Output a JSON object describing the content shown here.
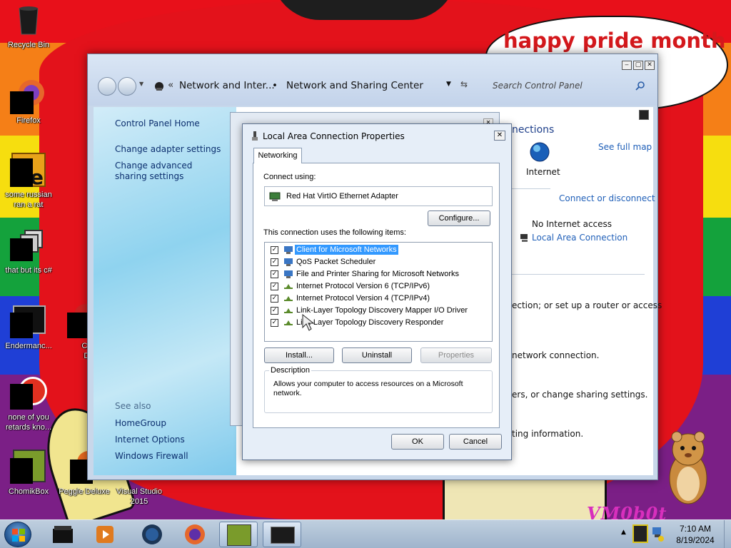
{
  "desktop": {
    "bubble_text": "happy pride month",
    "watermark_text": "VM0b0t",
    "icons": [
      {
        "label": "Recycle Bin"
      },
      {
        "label": "Firefox"
      },
      {
        "label": "some russian ran a rat"
      },
      {
        "label": "that but its c#"
      },
      {
        "label": "Endermanc..."
      },
      {
        "label": "Chuz Delu"
      },
      {
        "label": "none of you retards kno..."
      },
      {
        "label": "ChomikBox"
      },
      {
        "label": "Peggle Deluxe"
      },
      {
        "label": "Visual Studio 2015"
      }
    ]
  },
  "explorer": {
    "breadcrumb": {
      "sep1": "«",
      "part1": "Network and Inter...",
      "sep2": "•",
      "part2": "Network and Sharing Center"
    },
    "search_placeholder": "Search Control Panel",
    "sidebar": {
      "home": "Control Panel Home",
      "links": [
        "Change adapter settings",
        "Change advanced sharing settings"
      ],
      "see_also": "See also",
      "see_also_links": [
        "HomeGroup",
        "Internet Options",
        "Windows Firewall"
      ]
    },
    "main": {
      "connections_heading_fragment": "nections",
      "see_full_map": "See full map",
      "internet_label": "Internet",
      "connect_disconnect": "Connect or disconnect",
      "no_internet_access": "No Internet access",
      "local_area_connection": "Local Area Connection",
      "frag_router": "ection; or set up a router or access",
      "frag_network": "network connection.",
      "frag_sharing": "ers, or change sharing settings.",
      "frag_info": "ting information."
    }
  },
  "properties_dialog": {
    "title": "Local Area Connection Properties",
    "close_label": "✕",
    "tab": "Networking",
    "connect_using_label": "Connect using:",
    "adapter_name": "Red Hat VirtIO Ethernet Adapter",
    "configure_button": "Configure...",
    "items_label": "This connection uses the following items:",
    "items": [
      {
        "label": "Client for Microsoft Networks",
        "checked": true,
        "selected": true
      },
      {
        "label": "QoS Packet Scheduler",
        "checked": true,
        "selected": false
      },
      {
        "label": "File and Printer Sharing for Microsoft Networks",
        "checked": true,
        "selected": false
      },
      {
        "label": "Internet Protocol Version 6 (TCP/IPv6)",
        "checked": true,
        "selected": false
      },
      {
        "label": "Internet Protocol Version 4 (TCP/IPv4)",
        "checked": true,
        "selected": false
      },
      {
        "label": "Link-Layer Topology Discovery Mapper I/O Driver",
        "checked": true,
        "selected": false
      },
      {
        "label": "Link-Layer Topology Discovery Responder",
        "checked": true,
        "selected": false
      }
    ],
    "install_button": "Install...",
    "uninstall_button": "Uninstall",
    "properties_button": "Properties",
    "description_label": "Description",
    "description_text": "Allows your computer to access resources on a Microsoft network.",
    "ok_button": "OK",
    "cancel_button": "Cancel"
  },
  "taskbar": {
    "time": "7:10 AM",
    "date": "8/19/2024"
  },
  "colors": {
    "link_blue": "#1f5fb8",
    "selection_blue": "#3399ff"
  }
}
